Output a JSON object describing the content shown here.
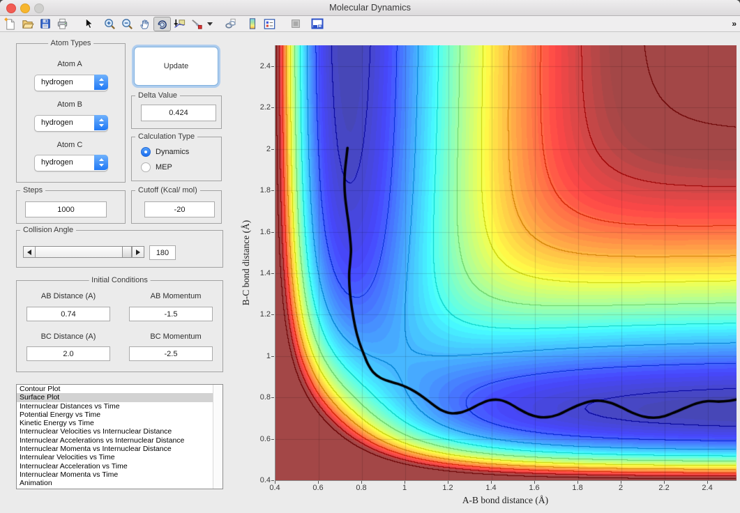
{
  "window": {
    "title": "Molecular Dynamics",
    "buttons": [
      {
        "name": "close",
        "color": "#f25c53"
      },
      {
        "name": "minimize",
        "color": "#f7b62e"
      },
      {
        "name": "zoom",
        "color": "#cfcfcd",
        "disabled": true
      }
    ]
  },
  "toolbar": {
    "icons": [
      {
        "name": "new-figure"
      },
      {
        "name": "open-file"
      },
      {
        "name": "save-figure"
      },
      {
        "name": "print-figure"
      },
      {
        "name": "edit-plot-pointer"
      },
      {
        "name": "zoom-in"
      },
      {
        "name": "zoom-out"
      },
      {
        "name": "pan-hand"
      },
      {
        "name": "rotate-3d",
        "active": true
      },
      {
        "name": "data-cursor"
      },
      {
        "name": "brush-data",
        "has_menu": true
      },
      {
        "name": "link-plot"
      },
      {
        "name": "insert-colorbar"
      },
      {
        "name": "insert-legend"
      },
      {
        "name": "hide-plot-tools"
      },
      {
        "name": "show-plot-tools"
      }
    ],
    "overflow_glyph": "»"
  },
  "controls": {
    "atom_types": {
      "title": "Atom Types",
      "fields": [
        {
          "label": "Atom A",
          "value": "hydrogen"
        },
        {
          "label": "Atom B",
          "value": "hydrogen"
        },
        {
          "label": "Atom C",
          "value": "hydrogen"
        }
      ]
    },
    "update_button": {
      "label": "Update"
    },
    "delta_value": {
      "title": "Delta Value",
      "value": "0.424"
    },
    "calculation_type": {
      "title": "Calculation Type",
      "options": [
        {
          "label": "Dynamics",
          "selected": true
        },
        {
          "label": "MEP",
          "selected": false
        }
      ]
    },
    "steps": {
      "title": "Steps",
      "value": "1000"
    },
    "cutoff": {
      "title": "Cutoff (Kcal/ mol)",
      "value": "-20"
    },
    "collision_angle": {
      "title": "Collision Angle",
      "value": "180",
      "slider_fraction": 1.0
    },
    "initial_conditions": {
      "title": "Initial Conditions",
      "fields": [
        {
          "label": "AB Distance (A)",
          "value": "0.74"
        },
        {
          "label": "AB Momentum",
          "value": "-1.5"
        },
        {
          "label": "BC Distance (A)",
          "value": "2.0"
        },
        {
          "label": "BC Momentum",
          "value": "-2.5"
        }
      ]
    },
    "plot_list": {
      "selected_index": 1,
      "items": [
        "Contour Plot",
        "Surface Plot",
        "Internuclear Distances vs Time",
        "Potential Energy vs Time",
        "Kinetic Energy vs Time",
        "Internuclear Velocities vs Internuclear Distance",
        "Internuclear Accelerations vs Internuclear Distance",
        "Internuclear Momenta vs Internuclear Distance",
        "Internulear Velocities vs Time",
        "Internuclear Acceleration vs Time",
        "Internuclear Momenta vs Time",
        "Animation"
      ]
    }
  },
  "chart_data": {
    "type": "filled_contour",
    "xlabel": "A-B bond distance (Å)",
    "ylabel": "B-C bond distance (Å)",
    "x_range": [
      0.4,
      2.532
    ],
    "y_range": [
      0.4,
      2.501
    ],
    "x_ticks": [
      "0.4",
      "0.6",
      "0.8",
      "1",
      "1.2",
      "1.4",
      "1.6",
      "1.8",
      "2",
      "2.2",
      "2.4"
    ],
    "y_ticks": [
      "0.4",
      "0.6",
      "0.8",
      "1",
      "1.2",
      "1.4",
      "1.6",
      "1.8",
      "2",
      "2.2",
      "2.4"
    ],
    "grid": true,
    "grid_spacing": 0.2,
    "colormap": "jet",
    "caxis": [
      -110,
      -20
    ],
    "cutoff_kcal_mol": -20,
    "fill_bands": 56,
    "white_blend": 0.28,
    "line_levels": [
      -105,
      -95,
      -85,
      -75,
      -65,
      -55,
      -45,
      -35,
      -25,
      -15
    ],
    "line_darken": 0.82,
    "potential": {
      "model": "LEPS collinear A-B-C (H + H2)",
      "D_kcal_mol": 109.46,
      "alpha_inv_angstrom": 1.9426,
      "r0_angstrom": 0.7414,
      "sato": 0
    },
    "trajectory": {
      "color": "#000000",
      "width": 3.6,
      "start": [
        0.74,
        2.0
      ],
      "points": [
        [
          0.733,
          2.005
        ],
        [
          0.727,
          1.95
        ],
        [
          0.721,
          1.89
        ],
        [
          0.719,
          1.83
        ],
        [
          0.722,
          1.77
        ],
        [
          0.73,
          1.7
        ],
        [
          0.738,
          1.64
        ],
        [
          0.745,
          1.57
        ],
        [
          0.749,
          1.51
        ],
        [
          0.745,
          1.45
        ],
        [
          0.741,
          1.4
        ],
        [
          0.742,
          1.34
        ],
        [
          0.747,
          1.28
        ],
        [
          0.755,
          1.22
        ],
        [
          0.765,
          1.16
        ],
        [
          0.778,
          1.1
        ],
        [
          0.793,
          1.05
        ],
        [
          0.81,
          1.005
        ],
        [
          0.828,
          0.96
        ],
        [
          0.852,
          0.922
        ],
        [
          0.885,
          0.895
        ],
        [
          0.925,
          0.878
        ],
        [
          0.965,
          0.866
        ],
        [
          1.005,
          0.85
        ],
        [
          1.045,
          0.828
        ],
        [
          1.085,
          0.8
        ],
        [
          1.125,
          0.768
        ],
        [
          1.165,
          0.74
        ],
        [
          1.21,
          0.724
        ],
        [
          1.255,
          0.727
        ],
        [
          1.3,
          0.744
        ],
        [
          1.345,
          0.768
        ],
        [
          1.39,
          0.786
        ],
        [
          1.435,
          0.788
        ],
        [
          1.48,
          0.772
        ],
        [
          1.525,
          0.744
        ],
        [
          1.57,
          0.72
        ],
        [
          1.615,
          0.706
        ],
        [
          1.66,
          0.705
        ],
        [
          1.705,
          0.716
        ],
        [
          1.75,
          0.738
        ],
        [
          1.8,
          0.762
        ],
        [
          1.85,
          0.78
        ],
        [
          1.9,
          0.784
        ],
        [
          1.95,
          0.774
        ],
        [
          2.0,
          0.752
        ],
        [
          2.05,
          0.726
        ],
        [
          2.1,
          0.708
        ],
        [
          2.15,
          0.702
        ],
        [
          2.2,
          0.71
        ],
        [
          2.25,
          0.73
        ],
        [
          2.3,
          0.752
        ],
        [
          2.35,
          0.772
        ],
        [
          2.4,
          0.782
        ],
        [
          2.45,
          0.78
        ],
        [
          2.5,
          0.784
        ],
        [
          2.532,
          0.79
        ]
      ]
    }
  },
  "colors": {
    "accent_blue": "#2079f5",
    "selection_gray": "#d2d2d2",
    "figure_bg": "#ebebeb",
    "clip_maroon": "#a34747"
  }
}
